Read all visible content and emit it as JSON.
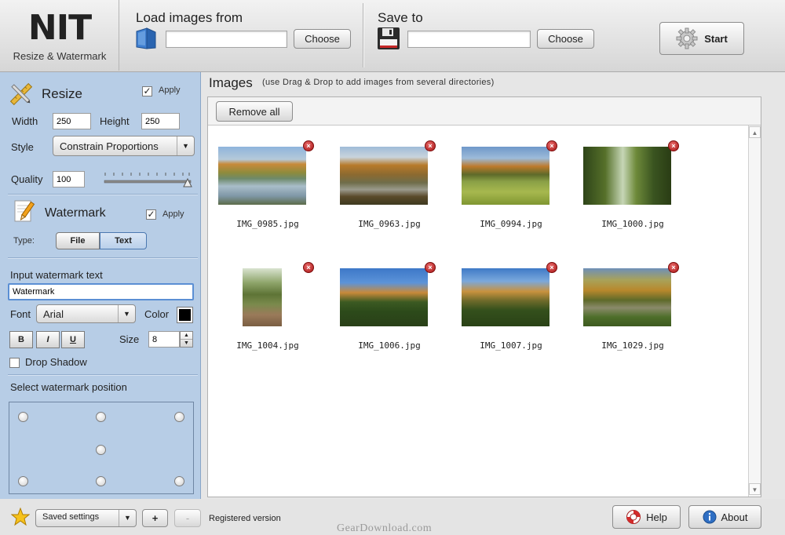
{
  "app": {
    "logo_title": "NIT",
    "logo_subtitle": "Resize & Watermark"
  },
  "header": {
    "load_label": "Load images from",
    "load_value": "",
    "load_choose": "Choose",
    "save_label": "Save to",
    "save_value": "",
    "save_choose": "Choose",
    "start_label": "Start"
  },
  "resize": {
    "title": "Resize",
    "apply_label": "Apply",
    "apply_checked": "✓",
    "width_label": "Width",
    "width_value": "250",
    "height_label": "Height",
    "height_value": "250",
    "style_label": "Style",
    "style_value": "Constrain Proportions",
    "quality_label": "Quality",
    "quality_value": "100"
  },
  "watermark": {
    "title": "Watermark",
    "apply_label": "Apply",
    "apply_checked": "✓",
    "type_label": "Type:",
    "type_file": "File",
    "type_text": "Text",
    "input_label": "Input watermark text",
    "input_value": "Watermark",
    "font_label": "Font",
    "font_value": "Arial",
    "color_label": "Color",
    "color_value": "#000000",
    "bold": "B",
    "italic": "I",
    "underline": "U",
    "size_label": "Size",
    "size_value": "8",
    "drop_shadow_label": "Drop Shadow",
    "position_label": "Select watermark position"
  },
  "images": {
    "title": "Images",
    "hint": "(use Drag & Drop to add images from several directories)",
    "remove_all": "Remove all",
    "items": [
      {
        "name": "IMG_0985.jpg"
      },
      {
        "name": "IMG_0963.jpg"
      },
      {
        "name": "IMG_0994.jpg"
      },
      {
        "name": "IMG_1000.jpg"
      },
      {
        "name": "IMG_1004.jpg"
      },
      {
        "name": "IMG_1006.jpg"
      },
      {
        "name": "IMG_1007.jpg"
      },
      {
        "name": "IMG_1029.jpg"
      }
    ]
  },
  "footer": {
    "saved_settings": "Saved settings",
    "add": "+",
    "remove": "-",
    "registered": "Registered version",
    "help": "Help",
    "about": "About",
    "watermark_text": "GearDownload.com"
  }
}
